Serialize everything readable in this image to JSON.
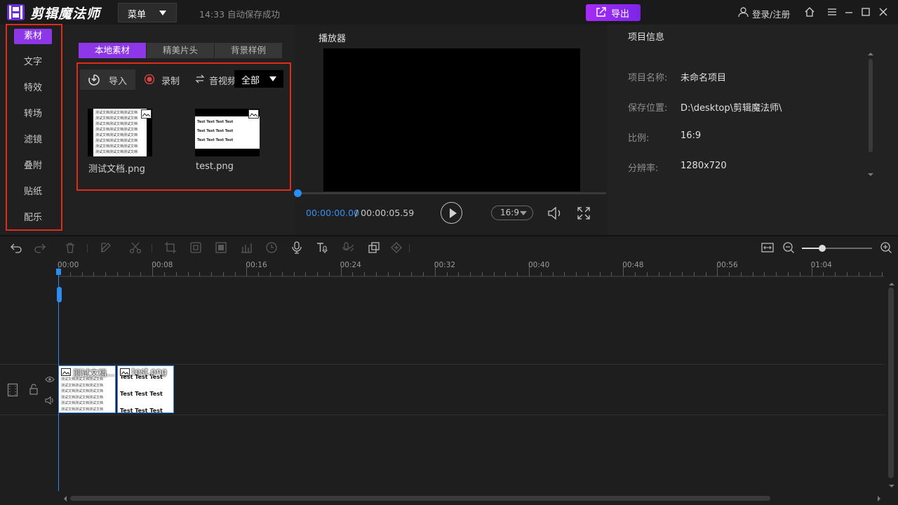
{
  "app": {
    "title": "剪辑魔法师",
    "menu_label": "菜单",
    "autosave_text": "14:33 自动保存成功",
    "export_label": "导出",
    "login_label": "登录/注册"
  },
  "sidebar": {
    "items": [
      {
        "label": "素材",
        "active": true
      },
      {
        "label": "文字"
      },
      {
        "label": "特效"
      },
      {
        "label": "转场"
      },
      {
        "label": "滤镜"
      },
      {
        "label": "叠附"
      },
      {
        "label": "贴纸"
      },
      {
        "label": "配乐"
      }
    ]
  },
  "material": {
    "tabs": [
      {
        "label": "本地素材",
        "active": true
      },
      {
        "label": "精美片头"
      },
      {
        "label": "背景样例"
      }
    ],
    "import_label": "导入",
    "record_label": "录制",
    "av_label": "音视频",
    "filter_value": "全部",
    "files": [
      {
        "name": "测试文档.png",
        "preview_text": "测试文档测试文档测试文档"
      },
      {
        "name": "test.png",
        "preview_text": "Test Test Test Test"
      }
    ]
  },
  "player": {
    "title": "播放器",
    "current_time": "00:00:00.00",
    "total_time": "/ 00:00:05.59",
    "ratio": "16:9",
    "progress": 0
  },
  "project_info": {
    "title": "项目信息",
    "rows": [
      {
        "label": "项目名称:",
        "value": "未命名项目"
      },
      {
        "label": "保存位置:",
        "value": "D:\\desktop\\剪辑魔法师\\"
      },
      {
        "label": "比例:",
        "value": "16:9"
      },
      {
        "label": "分辨率:",
        "value": "1280x720"
      }
    ]
  },
  "timeline": {
    "ruler_labels": [
      "00:00",
      "00:08",
      "00:16",
      "00:24",
      "00:32",
      "00:40",
      "00:48",
      "00:56",
      "01:04"
    ],
    "zoom_level": 0.29,
    "clips": [
      {
        "name": "测试文档...",
        "preview_text": "测试文档测试文档测试文档"
      },
      {
        "name": "test.png",
        "preview_text": "Test Test Test"
      }
    ]
  },
  "colors": {
    "accent": "#8d37e8",
    "export_gradient_start": "#a62cf5",
    "highlight_frame": "#e02a1c",
    "playhead": "#2d8cf0"
  }
}
